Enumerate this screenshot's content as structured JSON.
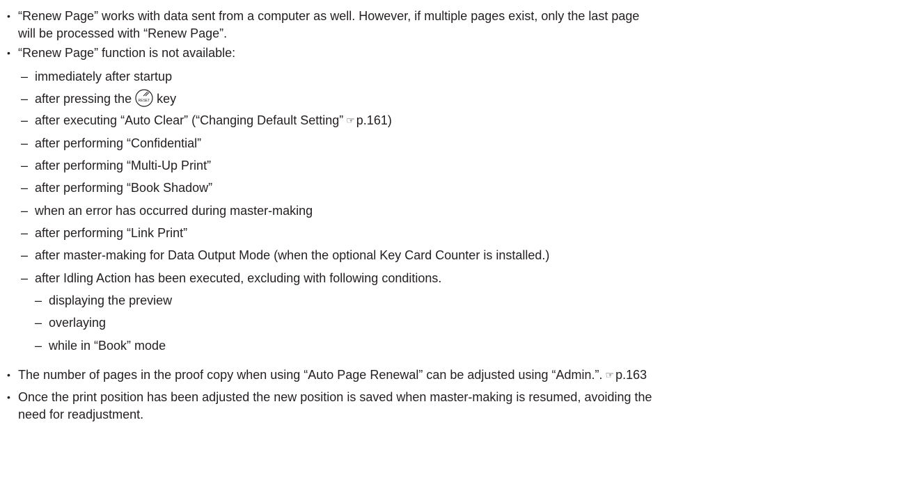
{
  "bullets": [
    {
      "line1": "“Renew Page” works with data sent from a computer as well. However, if multiple pages exist, only the last page",
      "line2": "will be processed with “Renew Page”."
    },
    {
      "line1": "“Renew Page” function is not available:"
    }
  ],
  "conditions": [
    "immediately after startup",
    "after pressing the",
    "key",
    "after executing “Auto Clear” (“Changing Default Setting”",
    "p.161)",
    "after performing “Confidential”",
    "after performing “Multi-Up Print”",
    "after performing “Book Shadow”",
    "when an error has occurred during master-making",
    "after performing “Link Print”",
    "after master-making for Data Output Mode (when the optional Key Card Counter is installed.)",
    "after Idling Action has been executed, excluding with following conditions."
  ],
  "exceptions": [
    "displaying the preview",
    "overlaying",
    "while in “Book” mode"
  ],
  "notes": [
    {
      "line1": "The number of pages in the proof copy when using “Auto Page Renewal” can be adjusted using “Admin.”.",
      "ref": "p.163"
    },
    {
      "line1": "Once the print position has been adjusted the new position is saved when master-making is resumed, avoiding the",
      "line2": "need for readjustment."
    }
  ],
  "symbols": {
    "bullet": "•",
    "dash": "–",
    "reset_key_label": "RESET",
    "ref_pointer": "☞"
  }
}
